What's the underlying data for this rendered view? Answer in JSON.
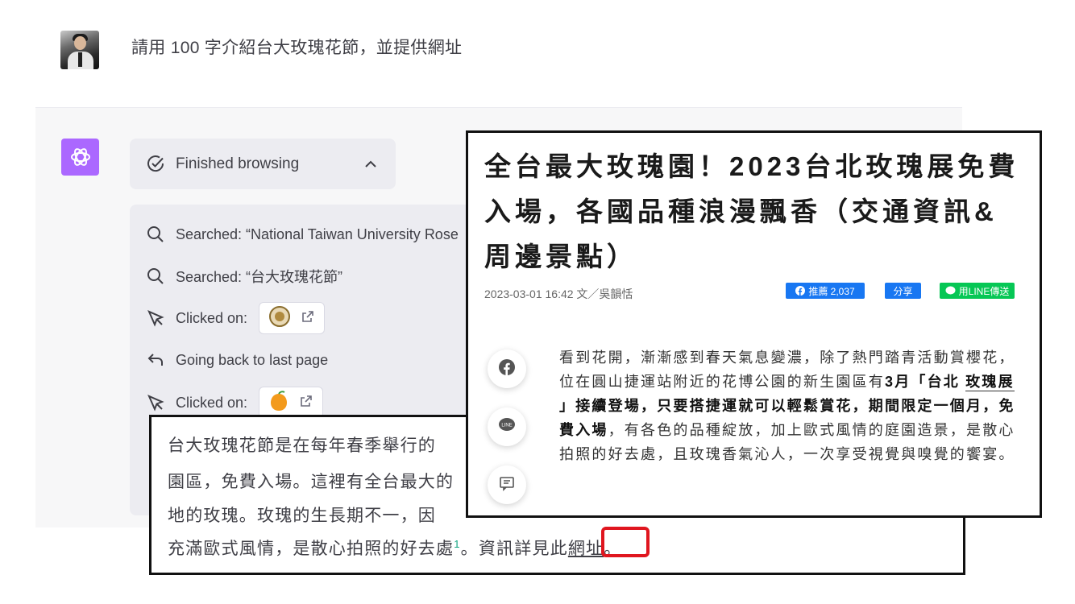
{
  "user_message": "請用 100 字介紹台大玫瑰花節，並提供網址",
  "browsing": {
    "header_label": "Finished browsing",
    "steps": [
      {
        "icon": "search-icon",
        "text": "Searched: “National Taiwan University Rose"
      },
      {
        "icon": "search-icon",
        "text": "Searched: “台大玫瑰花節”"
      },
      {
        "icon": "cursor-icon",
        "text": "Clicked on:"
      },
      {
        "icon": "back-arrow-icon",
        "text": "Going back to last page"
      },
      {
        "icon": "cursor-icon",
        "text": "Clicked on:"
      }
    ]
  },
  "answer": {
    "line1": "台大玫瑰花節是在每年春季舉行的",
    "line2": "園區，免費入場。這裡有全台最大的",
    "line3": "地的玫瑰。玫瑰的生長期不一，因",
    "line4_pre": "充滿歐式風情，是散心拍照的好去處",
    "footnote": "1",
    "line4_mid": "。資訊詳見此",
    "link_text": "網址",
    "line4_post": "。"
  },
  "article": {
    "title": "全台最大玫瑰園！2023台北玫瑰展免費入場，各國品種浪漫飄香（交通資訊&周邊景點）",
    "meta": "2023-03-01 16:42 文／吳韻恬",
    "fb_label": "推薦 2,037",
    "share_label": "分享",
    "line_label": "用LINE傳送",
    "body": {
      "p1": "看到花開，漸漸感到春天氣息變濃，除了熱門踏青活動賞櫻花，位在圓山捷運站附近的花博公園的新生園區有",
      "b1": "3月「台北 ",
      "b1_link": "玫瑰展",
      "b2": " 」接續登場，只要搭捷運就可以輕鬆賞花，期間限定一個月，免費入場",
      "p2": "，有各色的品種綻放，加上歐式風情的庭園造景，是散心拍照的好去處，且玫瑰香氣沁人，一次享受視覺與嗅覺的饗宴。"
    }
  },
  "colors": {
    "gpt_logo": "#ab68ff",
    "facebook": "#1877f2",
    "line": "#06c755",
    "highlight": "#e0161f"
  }
}
